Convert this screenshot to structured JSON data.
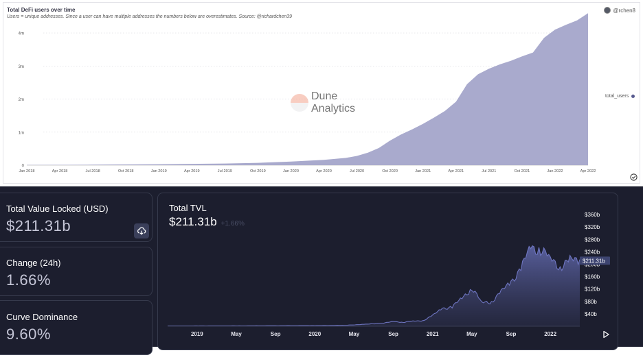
{
  "dune_panel": {
    "title": "Total DeFi users over time",
    "subtitle": "Users = unique addresses. Since a user can have multiple addresses the numbers below are overestimates. Source: @richardchen39",
    "author": "@rchen8",
    "watermark_line1": "Dune",
    "watermark_line2": "Analytics",
    "legend_label": "total_users",
    "icons": [
      "avatar",
      "check-circle-icon",
      "dune-logo"
    ]
  },
  "chart_data": [
    {
      "type": "area",
      "title": "Total DeFi users over time",
      "x_tick_labels": [
        "Jan 2018",
        "Apr 2018",
        "Jul 2018",
        "Oct 2018",
        "Jan 2019",
        "Apr 2019",
        "Jul 2019",
        "Oct 2019",
        "Jan 2020",
        "Apr 2020",
        "Jul 2020",
        "Oct 2020",
        "Jan 2021",
        "Apr 2021",
        "Jul 2021",
        "Oct 2021",
        "Jan 2022",
        "Apr 2022"
      ],
      "y_tick_labels": [
        "0",
        "1m",
        "2m",
        "3m",
        "4m"
      ],
      "ylim": [
        0,
        4500000
      ],
      "x_range": [
        "2018-01",
        "2022-04"
      ],
      "grid": true,
      "legend_placement": "right",
      "series": [
        {
          "name": "total_users",
          "color": "#a9aacd",
          "x": [
            "2018-01",
            "2018-07",
            "2019-01",
            "2019-07",
            "2019-10",
            "2020-01",
            "2020-04",
            "2020-06",
            "2020-07",
            "2020-08",
            "2020-09",
            "2020-10",
            "2020-11",
            "2020-12",
            "2021-01",
            "2021-02",
            "2021-03",
            "2021-04",
            "2021-05",
            "2021-06",
            "2021-07",
            "2021-08",
            "2021-09",
            "2021-10",
            "2021-11",
            "2021-12",
            "2022-01",
            "2022-02",
            "2022-03",
            "2022-04"
          ],
          "values": [
            5000,
            15000,
            30000,
            50000,
            70000,
            110000,
            160000,
            220000,
            280000,
            380000,
            520000,
            740000,
            930000,
            1080000,
            1250000,
            1440000,
            1640000,
            1920000,
            2450000,
            2750000,
            2920000,
            3050000,
            3160000,
            3290000,
            3410000,
            3850000,
            4100000,
            4250000,
            4380000,
            4600000
          ]
        }
      ]
    },
    {
      "type": "area",
      "title": "Total TVL",
      "x_tick_labels": [
        "2019",
        "May",
        "Sep",
        "2020",
        "May",
        "Sep",
        "2021",
        "May",
        "Sep",
        "2022"
      ],
      "y_tick_labels": [
        "$360b",
        "$320b",
        "$280b",
        "$240b",
        "$200b",
        "$160b",
        "$120b",
        "$80b",
        "$40b"
      ],
      "ylim": [
        0,
        380
      ],
      "x_range": [
        "2018-10",
        "2022-04"
      ],
      "current_value_label": "$211.31b",
      "series": [
        {
          "name": "TVL",
          "color": "#5c63a3",
          "x": [
            "2018-10",
            "2019-06",
            "2020-01",
            "2020-04",
            "2020-06",
            "2020-08",
            "2020-09",
            "2020-10",
            "2020-11",
            "2020-12",
            "2021-01",
            "2021-02",
            "2021-03",
            "2021-04",
            "2021-05",
            "2021-06",
            "2021-07",
            "2021-08",
            "2021-09",
            "2021-10",
            "2021-11",
            "2021-12",
            "2022-01",
            "2022-02",
            "2022-03",
            "2022-04"
          ],
          "values": [
            1,
            1.5,
            2,
            3,
            6,
            10,
            15,
            13,
            16,
            18,
            34,
            58,
            62,
            90,
            125,
            75,
            80,
            110,
            145,
            185,
            255,
            250,
            215,
            195,
            210,
            215
          ]
        }
      ]
    }
  ],
  "stats": {
    "tvl_label": "Total Value Locked (USD)",
    "tvl_value": "$211.31b",
    "change_label": "Change (24h)",
    "change_value": "1.66%",
    "curve_label": "Curve Dominance",
    "curve_value": "9.60%"
  },
  "tvl_chart": {
    "title": "Total TVL",
    "value": "$211.31b",
    "change": "+1.66%",
    "area_color": "#5c63a3",
    "icons": [
      "download-icon",
      "play-icon"
    ]
  }
}
